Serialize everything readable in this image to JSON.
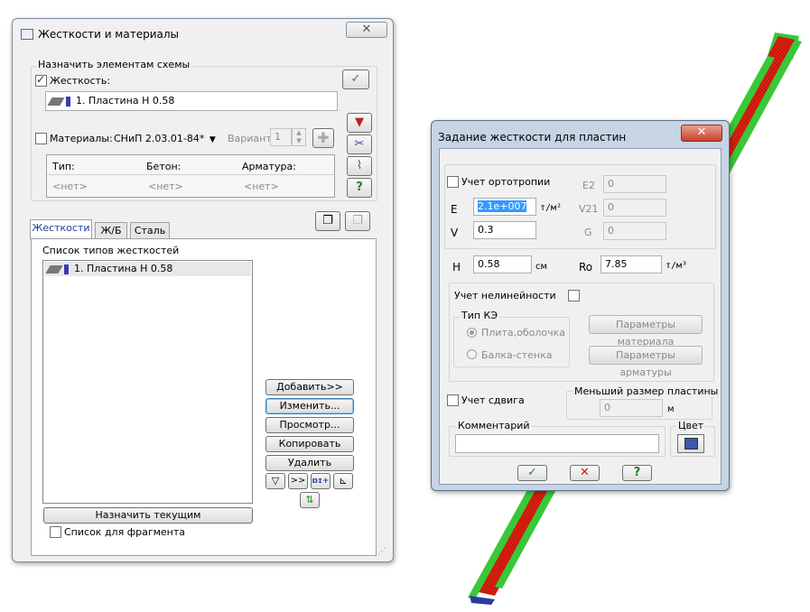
{
  "main_window": {
    "title": "Жесткости и материалы",
    "close_glyph": "✕",
    "assign_group": "Назначить элементам схемы",
    "stiffness_label": "Жесткость:",
    "stiffness_value": "1. Пластина  H 0.58",
    "materials_label": "Материалы:",
    "materials_norm": "СНиП 2.03.01-84*",
    "variant_label": "Вариант",
    "variant_value": "1",
    "mat_table": {
      "headers": [
        "Тип:",
        "Бетон:",
        "Арматура:"
      ],
      "row": [
        "<нет>",
        "<нет>",
        "<нет>"
      ]
    },
    "tabs": [
      "Жесткости",
      "Ж/Б",
      "Сталь"
    ],
    "list_title": "Список типов жесткостей",
    "list_items": [
      "1. Пластина  H 0.58"
    ],
    "buttons": {
      "add": "Добавить>>",
      "edit": "Изменить...",
      "view": "Просмотр...",
      "copy": "Копировать",
      "delete": "Удалить",
      "assign_current": "Назначить текущим",
      "shift_label": ">>",
      "dim_label": "ɒɪ+"
    },
    "fragment_label": "Список для фрагмента"
  },
  "dialog": {
    "title": "Задание жесткости для пластин",
    "close_glyph": "✕",
    "ortho_label": "Учет ортотропии",
    "E_label": "E",
    "E_value": "2.1e+007",
    "E_unit": "т/м²",
    "V_label": "V",
    "V_value": "0.3",
    "E2_label": "E2",
    "E2_value": "0",
    "V21_label": "V21",
    "V21_value": "0",
    "G_label": "G",
    "G_value": "0",
    "H_label": "H",
    "H_value": "0.58",
    "H_unit": "см",
    "Ro_label": "Ro",
    "Ro_value": "7.85",
    "Ro_unit": "т/м³",
    "nonlin_label": "Учет нелинейности",
    "fe_type_label": "Тип КЭ",
    "radio_plate": "Плита,оболочка",
    "radio_wall": "Балка-стенка",
    "btn_material": "Параметры материала",
    "btn_rebar": "Параметры арматуры",
    "shear_label": "Учет сдвига",
    "min_size_label": "Меньший размер пластины",
    "min_size_value": "0",
    "min_size_unit": "м",
    "comment_label": "Комментарий",
    "comment_value": "",
    "color_label": "Цвет",
    "color_value": "#3c58a8",
    "ok_glyph": "✓",
    "cancel_glyph": "✕",
    "help_glyph": "?"
  },
  "colors": {
    "beam_red": "#e02010",
    "beam_green": "#38c838"
  }
}
